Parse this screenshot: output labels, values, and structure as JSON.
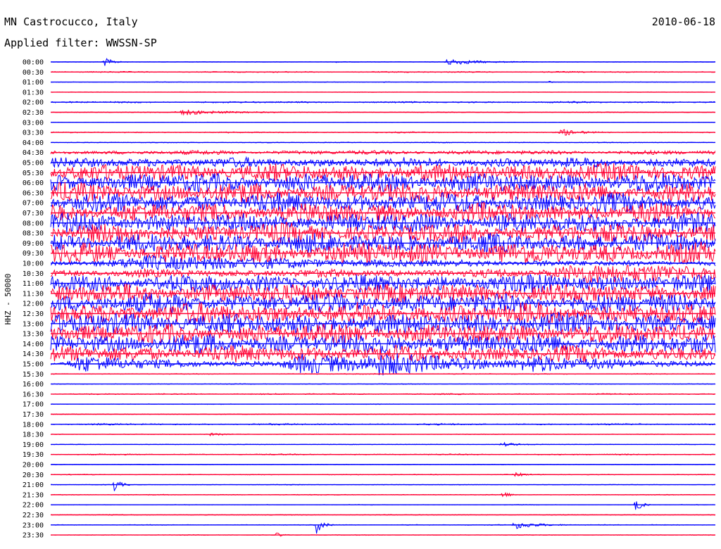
{
  "header": {
    "station": "MN Castrocucco, Italy",
    "date": "2010-06-18",
    "filter": "Applied filter: WWSSN-SP"
  },
  "chart_data": {
    "type": "line",
    "ylabel": "HHZ - 50000",
    "colors": [
      "#0000ff",
      "#ff0033"
    ],
    "rows": [
      {
        "time": "00:00",
        "noise": 0.03,
        "events": [
          {
            "at": 0.08,
            "amp": 0.5,
            "dur": 0.012
          },
          {
            "at": 0.6,
            "amp": 0.35,
            "dur": 0.04
          },
          {
            "at": 0.43,
            "amp": 0.15,
            "dur": 0.005
          }
        ]
      },
      {
        "time": "00:30",
        "noise": 0.07,
        "events": []
      },
      {
        "time": "01:00",
        "noise": 0.03,
        "events": [
          {
            "at": 0.5,
            "amp": 0.12,
            "dur": 0.005
          },
          {
            "at": 0.75,
            "amp": 0.12,
            "dur": 0.005
          }
        ]
      },
      {
        "time": "01:30",
        "noise": 0.03,
        "events": []
      },
      {
        "time": "02:00",
        "noise": 0.09,
        "events": []
      },
      {
        "time": "02:30",
        "noise": 0.05,
        "events": [
          {
            "at": 0.2,
            "amp": 0.3,
            "dur": 0.05
          }
        ]
      },
      {
        "time": "03:00",
        "noise": 0.03,
        "events": []
      },
      {
        "time": "03:30",
        "noise": 0.07,
        "events": [
          {
            "at": 0.77,
            "amp": 0.35,
            "dur": 0.02
          }
        ]
      },
      {
        "time": "04:00",
        "noise": 0.05,
        "events": []
      },
      {
        "time": "04:30",
        "noise": 0.25,
        "events": []
      },
      {
        "time": "05:00",
        "noise": 0.6,
        "events": []
      },
      {
        "time": "05:30",
        "noise": 1.1,
        "events": []
      },
      {
        "time": "06:00",
        "noise": 1.2,
        "events": []
      },
      {
        "time": "06:30",
        "noise": 1.2,
        "events": []
      },
      {
        "time": "07:00",
        "noise": 1.2,
        "events": []
      },
      {
        "time": "07:30",
        "noise": 1.2,
        "events": []
      },
      {
        "time": "08:00",
        "noise": 1.2,
        "events": []
      },
      {
        "time": "08:30",
        "noise": 1.2,
        "events": []
      },
      {
        "time": "09:00",
        "noise": 1.2,
        "events": []
      },
      {
        "time": "09:30",
        "noise": 1.3,
        "events": []
      },
      {
        "time": "10:00",
        "noise": 0.35,
        "events": [
          {
            "at": 0.15,
            "amp": 0.7,
            "dur": 0.2
          }
        ]
      },
      {
        "time": "10:30",
        "noise": 0.5,
        "events": [
          {
            "at": 0.8,
            "amp": 0.8,
            "dur": 0.25
          }
        ]
      },
      {
        "time": "11:00",
        "noise": 1.1,
        "events": []
      },
      {
        "time": "11:30",
        "noise": 1.2,
        "events": []
      },
      {
        "time": "12:00",
        "noise": 1.2,
        "events": []
      },
      {
        "time": "12:30",
        "noise": 1.3,
        "events": []
      },
      {
        "time": "13:00",
        "noise": 1.3,
        "events": []
      },
      {
        "time": "13:30",
        "noise": 1.2,
        "events": []
      },
      {
        "time": "14:00",
        "noise": 1.2,
        "events": []
      },
      {
        "time": "14:30",
        "noise": 1.0,
        "events": []
      },
      {
        "time": "15:00",
        "noise": 0.25,
        "events": [
          {
            "at": 0.05,
            "amp": 0.8,
            "dur": 0.1
          },
          {
            "at": 0.38,
            "amp": 1.0,
            "dur": 0.12
          },
          {
            "at": 0.5,
            "amp": 0.9,
            "dur": 0.12
          },
          {
            "at": 0.73,
            "amp": 0.7,
            "dur": 0.12
          }
        ]
      },
      {
        "time": "15:30",
        "noise": 0.05,
        "events": []
      },
      {
        "time": "16:00",
        "noise": 0.04,
        "events": []
      },
      {
        "time": "16:30",
        "noise": 0.07,
        "events": []
      },
      {
        "time": "17:00",
        "noise": 0.04,
        "events": []
      },
      {
        "time": "17:30",
        "noise": 0.04,
        "events": []
      },
      {
        "time": "18:00",
        "noise": 0.09,
        "events": []
      },
      {
        "time": "18:30",
        "noise": 0.04,
        "events": [
          {
            "at": 0.24,
            "amp": 0.12,
            "dur": 0.02
          }
        ]
      },
      {
        "time": "19:00",
        "noise": 0.04,
        "events": [
          {
            "at": 0.68,
            "amp": 0.2,
            "dur": 0.02
          }
        ]
      },
      {
        "time": "19:30",
        "noise": 0.07,
        "events": []
      },
      {
        "time": "20:00",
        "noise": 0.04,
        "events": []
      },
      {
        "time": "20:30",
        "noise": 0.05,
        "events": [
          {
            "at": 0.7,
            "amp": 0.25,
            "dur": 0.01
          }
        ]
      },
      {
        "time": "21:00",
        "noise": 0.04,
        "events": [
          {
            "at": 0.095,
            "amp": 0.8,
            "dur": 0.008
          }
        ]
      },
      {
        "time": "21:30",
        "noise": 0.05,
        "events": [
          {
            "at": 0.68,
            "amp": 0.4,
            "dur": 0.008
          }
        ]
      },
      {
        "time": "22:00",
        "noise": 0.04,
        "events": [
          {
            "at": 0.88,
            "amp": 0.85,
            "dur": 0.008
          }
        ]
      },
      {
        "time": "22:30",
        "noise": 0.05,
        "events": []
      },
      {
        "time": "23:00",
        "noise": 0.05,
        "events": [
          {
            "at": 0.4,
            "amp": 0.9,
            "dur": 0.008
          },
          {
            "at": 0.7,
            "amp": 0.4,
            "dur": 0.03
          }
        ]
      },
      {
        "time": "23:30",
        "noise": 0.04,
        "events": [
          {
            "at": 0.34,
            "amp": 0.25,
            "dur": 0.008
          }
        ]
      }
    ]
  }
}
